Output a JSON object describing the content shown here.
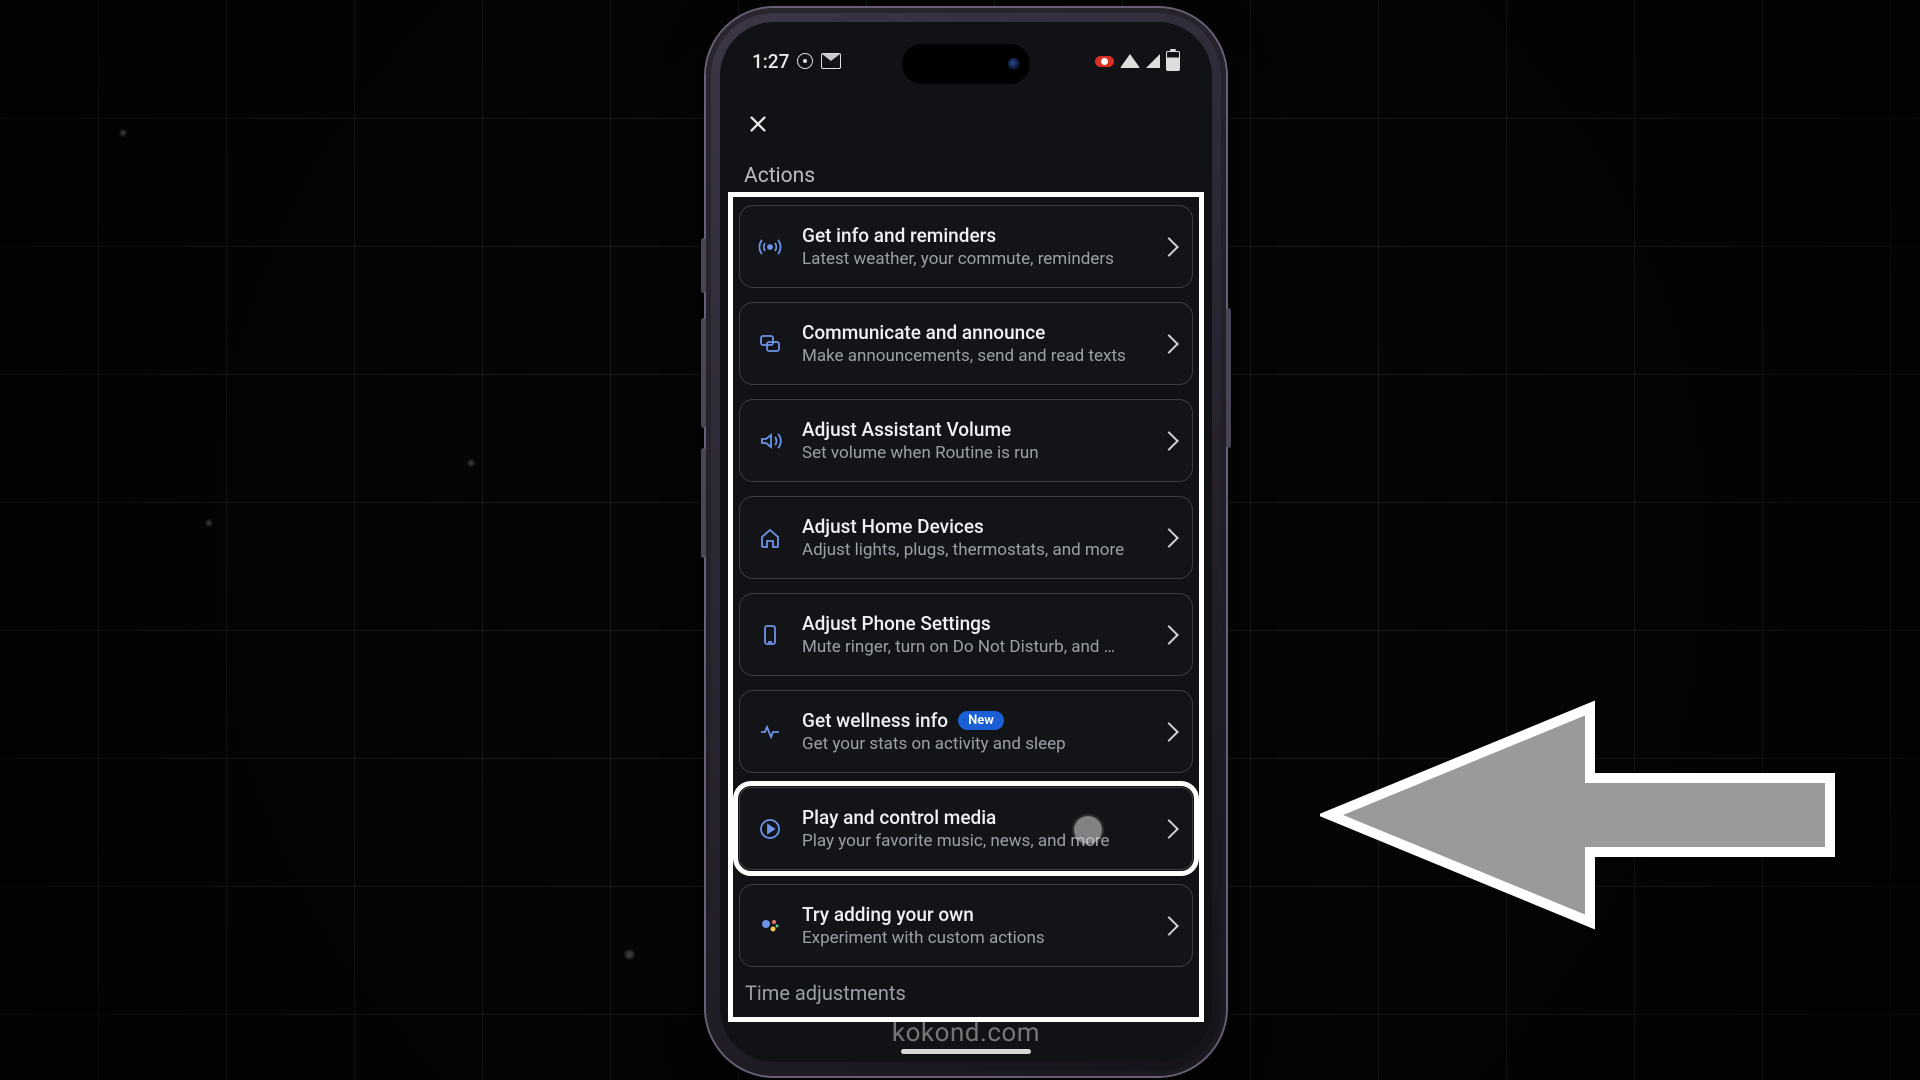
{
  "status": {
    "time": "1:27",
    "rec_label": ""
  },
  "header": {
    "section_title": "Actions"
  },
  "actions": [
    {
      "id": "info-reminders",
      "title": "Get info and reminders",
      "subtitle": "Latest weather, your commute, reminders",
      "icon": "broadcast-icon",
      "badge": null
    },
    {
      "id": "communicate",
      "title": "Communicate and announce",
      "subtitle": "Make announcements, send and read texts",
      "icon": "chat-icon",
      "badge": null
    },
    {
      "id": "assistant-volume",
      "title": "Adjust Assistant Volume",
      "subtitle": "Set volume when Routine is run",
      "icon": "volume-icon",
      "badge": null
    },
    {
      "id": "home-devices",
      "title": "Adjust Home Devices",
      "subtitle": "Adjust lights, plugs, thermostats, and more",
      "icon": "home-icon",
      "badge": null
    },
    {
      "id": "phone-settings",
      "title": "Adjust Phone Settings",
      "subtitle": "Mute ringer, turn on Do Not Disturb, and …",
      "icon": "phone-icon",
      "badge": null
    },
    {
      "id": "wellness",
      "title": "Get wellness info",
      "subtitle": "Get your stats on activity and sleep",
      "icon": "wellness-icon",
      "badge": "New"
    },
    {
      "id": "media",
      "title": "Play and control media",
      "subtitle": "Play your favorite music, news, and more",
      "icon": "play-icon",
      "badge": null,
      "emphasized": true
    },
    {
      "id": "custom",
      "title": "Try adding your own",
      "subtitle": "Experiment with custom actions",
      "icon": "assistant-icon",
      "badge": null
    }
  ],
  "footer_section": "Time adjustments",
  "watermark": "kokond.com"
}
